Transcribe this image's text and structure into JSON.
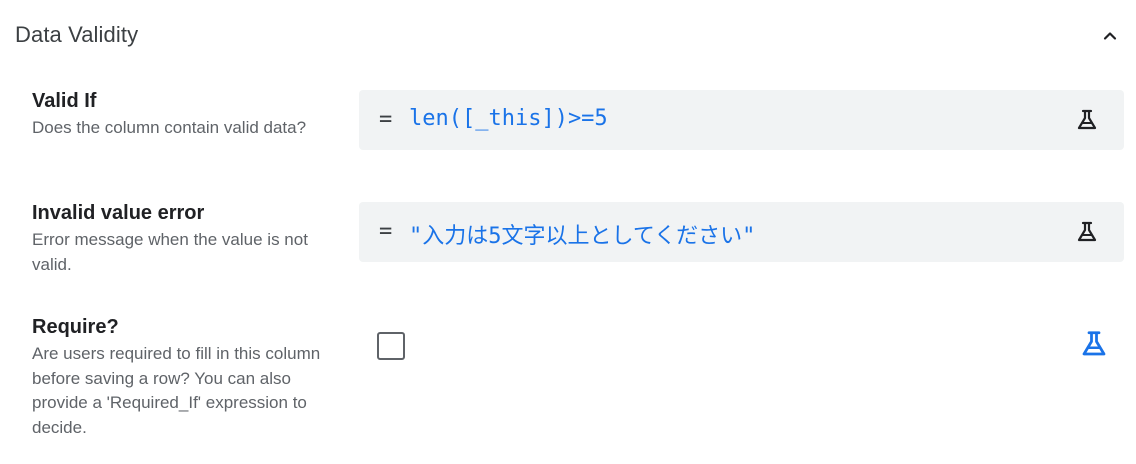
{
  "section": {
    "title": "Data Validity",
    "collapse_icon": "chevron-up-icon"
  },
  "fields": [
    {
      "label": "Valid If",
      "description": "Does the column contain valid data?",
      "prefix": "=",
      "expression": "len([_this])>=5",
      "icon": "flask-icon"
    },
    {
      "label": "Invalid value error",
      "description": "Error message when the value is not valid.",
      "prefix": "=",
      "expression": "\"入力は5文字以上としてください\"",
      "icon": "flask-icon"
    },
    {
      "label": "Require?",
      "description": "Are users required to fill in this column before saving a row? You can also provide a 'Required_If' expression to decide.",
      "checked": false,
      "icon": "flask-icon"
    }
  ],
  "colors": {
    "expression_text": "#1a73e8",
    "field_background": "#f1f3f4",
    "accent_icon": "#1a73e8"
  }
}
